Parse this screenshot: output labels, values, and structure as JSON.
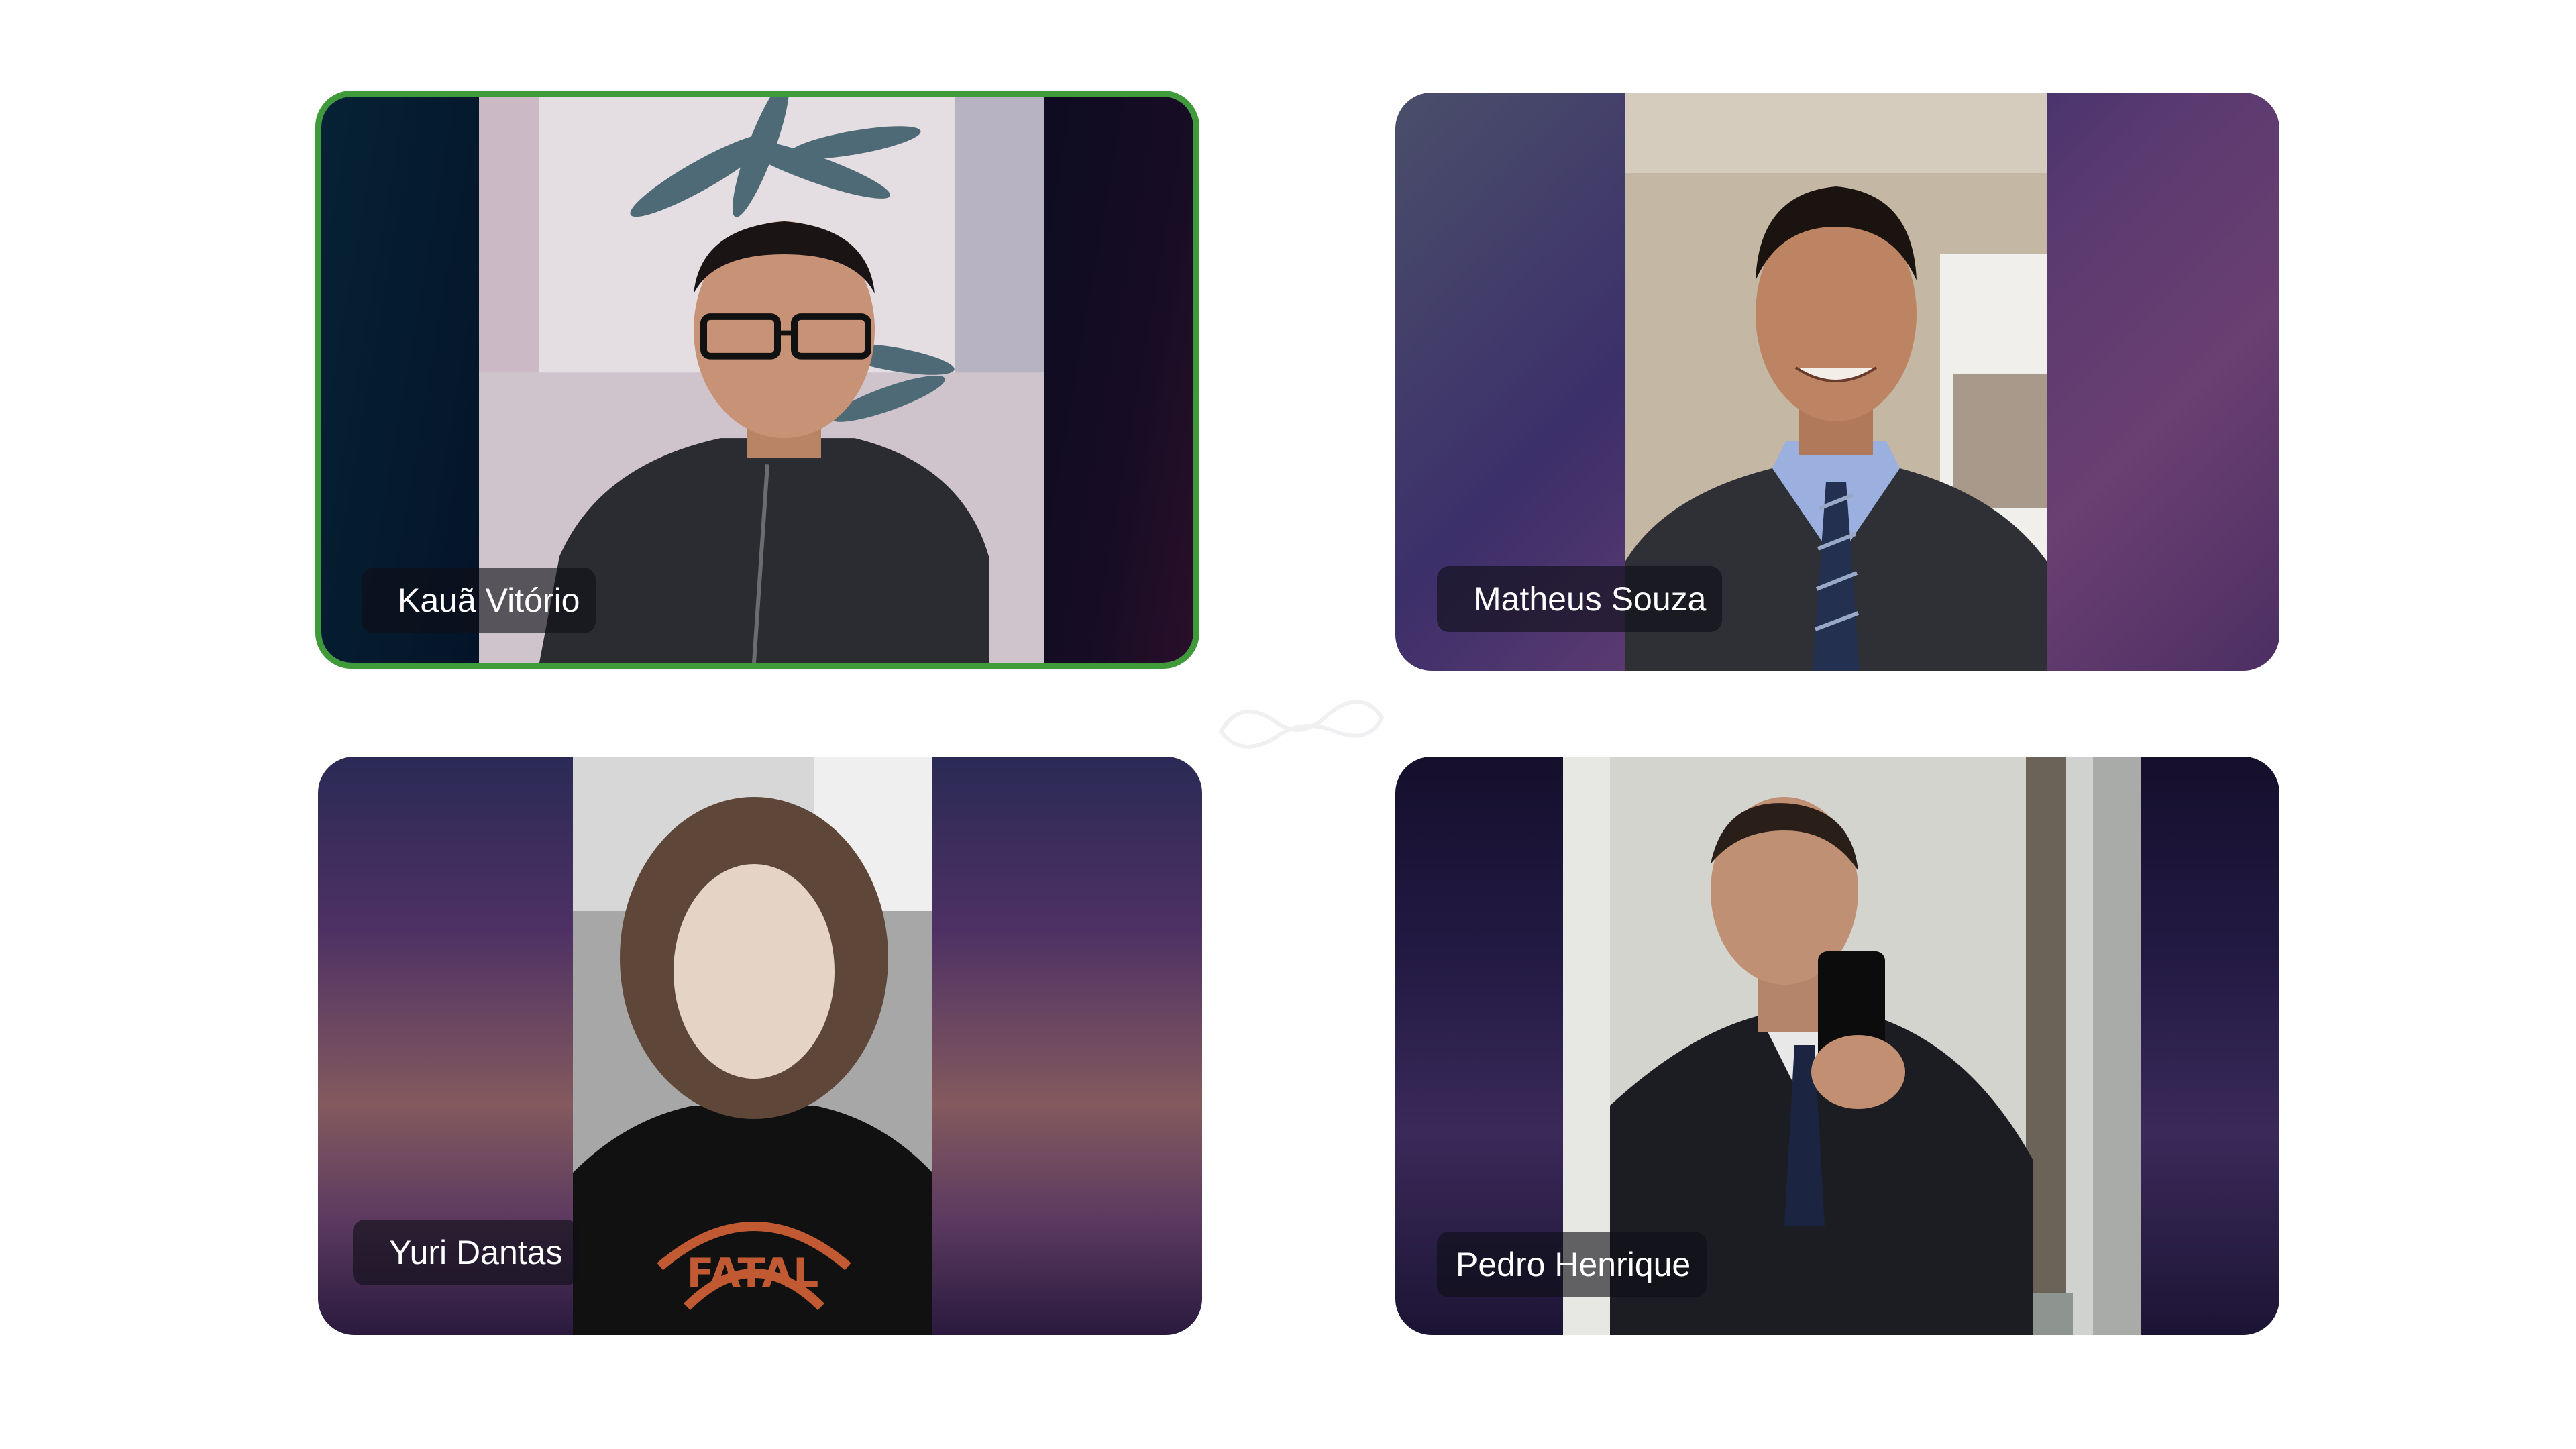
{
  "participants": [
    {
      "name": "Kauã Vitório",
      "speaking": true
    },
    {
      "name": "Matheus Souza",
      "speaking": false
    },
    {
      "name": "Yuri Dantas",
      "speaking": false
    },
    {
      "name": "Pedro Henrique",
      "speaking": false
    }
  ],
  "colors": {
    "active_speaker_border": "#3f9a3a",
    "background": "#ffffff",
    "name_label_text": "#ffffff"
  },
  "icons": {
    "center": "infinity-logo-icon"
  }
}
